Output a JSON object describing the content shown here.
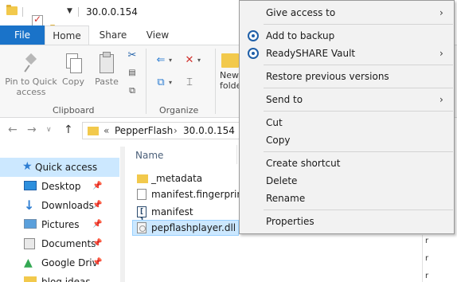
{
  "window": {
    "title": "30.0.0.154"
  },
  "ribbon": {
    "tabs": [
      {
        "label": "File"
      },
      {
        "label": "Home"
      },
      {
        "label": "Share"
      },
      {
        "label": "View"
      }
    ],
    "clipboard": {
      "pin_label_1": "Pin to Quick",
      "pin_label_2": "access",
      "copy_label": "Copy",
      "paste_label": "Paste",
      "group_label": "Clipboard"
    },
    "organize": {
      "group_label": "Organize"
    },
    "new": {
      "label_1": "New",
      "label_2": "folde"
    }
  },
  "address": {
    "overflow": "«",
    "crumbs": [
      "PepperFlash",
      "30.0.0.154"
    ],
    "separator": "›"
  },
  "nav_pane": {
    "items": [
      {
        "label": "Quick access",
        "icon": "star-icon",
        "pinned": false,
        "selected": true
      },
      {
        "label": "Desktop",
        "icon": "desktop-icon",
        "pinned": true
      },
      {
        "label": "Downloads",
        "icon": "download-icon",
        "pinned": true
      },
      {
        "label": "Pictures",
        "icon": "pictures-icon",
        "pinned": true
      },
      {
        "label": "Documents",
        "icon": "documents-icon",
        "pinned": true
      },
      {
        "label": "Google Driv",
        "icon": "google-drive-icon",
        "pinned": true
      },
      {
        "label": "blog ideas",
        "icon": "folder-icon",
        "pinned": false
      }
    ]
  },
  "file_list": {
    "column_name": "Name",
    "files": [
      {
        "name": "_metadata",
        "icon": "folder-icon"
      },
      {
        "name": "manifest.fingerprint",
        "icon": "file-icon"
      },
      {
        "name": "manifest",
        "icon": "json-file-icon"
      },
      {
        "name": "pepflashplayer.dll",
        "icon": "dll-file-icon",
        "selected": true
      }
    ]
  },
  "context_menu": {
    "items": [
      {
        "label": "Give access to",
        "submenu": true
      },
      {
        "label": "Add to backup",
        "icon": "backup-icon"
      },
      {
        "label": "ReadySHARE Vault",
        "icon": "backup-icon",
        "submenu": true
      },
      {
        "label": "Restore previous versions"
      },
      {
        "label": "Send to",
        "submenu": true
      },
      {
        "label": "Cut"
      },
      {
        "label": "Copy"
      },
      {
        "label": "Create shortcut"
      },
      {
        "label": "Delete"
      },
      {
        "label": "Rename"
      },
      {
        "label": "Properties"
      }
    ],
    "submenu_arrow": "›"
  },
  "colors": {
    "accent": "#1a73c9",
    "selection": "#cce8ff",
    "menu_background": "#f2f2f2"
  }
}
